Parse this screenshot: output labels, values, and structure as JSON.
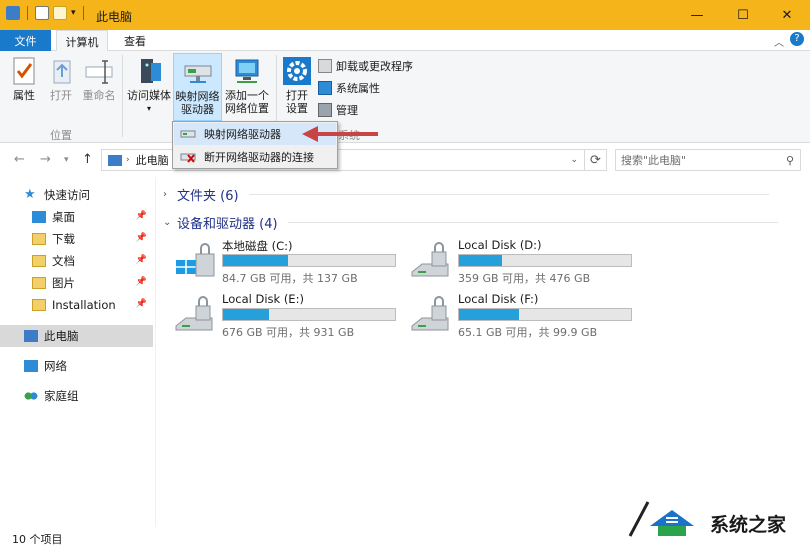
{
  "window": {
    "title": "此电脑",
    "minimize": "—",
    "maximize": "☐",
    "close": "✕",
    "accent": "#f4b41a"
  },
  "ribbon_tabs": [
    {
      "label": "文件"
    },
    {
      "label": "计算机"
    },
    {
      "label": "查看"
    }
  ],
  "ribbon": {
    "properties": "属性",
    "open": "打开",
    "rename": "重命名",
    "location_group": "位置",
    "access_media": "访问媒体",
    "map_drive_line1": "映射网络",
    "map_drive_line2": "驱动器",
    "add_location_line1": "添加一个",
    "add_location_line2": "网络位置",
    "open_settings_line1": "打开",
    "open_settings_line2": "设置",
    "uninstall": "卸载或更改程序",
    "system_properties": "系统属性",
    "manage": "管理",
    "system_group": "系统"
  },
  "dropdown": {
    "items": [
      {
        "label": "映射网络驱动器",
        "icon": "map-drive-icon"
      },
      {
        "label": "断开网络驱动器的连接",
        "icon": "disconnect-drive-icon"
      }
    ]
  },
  "address": {
    "path": "此电脑",
    "search_placeholder": "搜索\"此电脑\""
  },
  "nav_pane": {
    "quick_access": "快速访问",
    "items": [
      {
        "label": "桌面"
      },
      {
        "label": "下载"
      },
      {
        "label": "文档"
      },
      {
        "label": "图片"
      },
      {
        "label": "Installation"
      }
    ],
    "this_pc": "此电脑",
    "network": "网络",
    "homegroup": "家庭组"
  },
  "sections": {
    "folders": "文件夹 (6)",
    "devices": "设备和驱动器 (4)"
  },
  "drives": [
    {
      "name": "本地磁盘 (C:)",
      "info": "84.7 GB 可用，共 137 GB",
      "used_fraction": 0.38
    },
    {
      "name": "Local Disk (D:)",
      "info": "359 GB 可用，共 476 GB",
      "used_fraction": 0.25
    },
    {
      "name": "Local Disk (E:)",
      "info": "676 GB 可用，共 931 GB",
      "used_fraction": 0.27
    },
    {
      "name": "Local Disk (F:)",
      "info": "65.1 GB 可用，共 99.9 GB",
      "used_fraction": 0.35
    }
  ],
  "status": {
    "count": "10 个项目"
  },
  "watermark": {
    "text": "系统之家"
  }
}
